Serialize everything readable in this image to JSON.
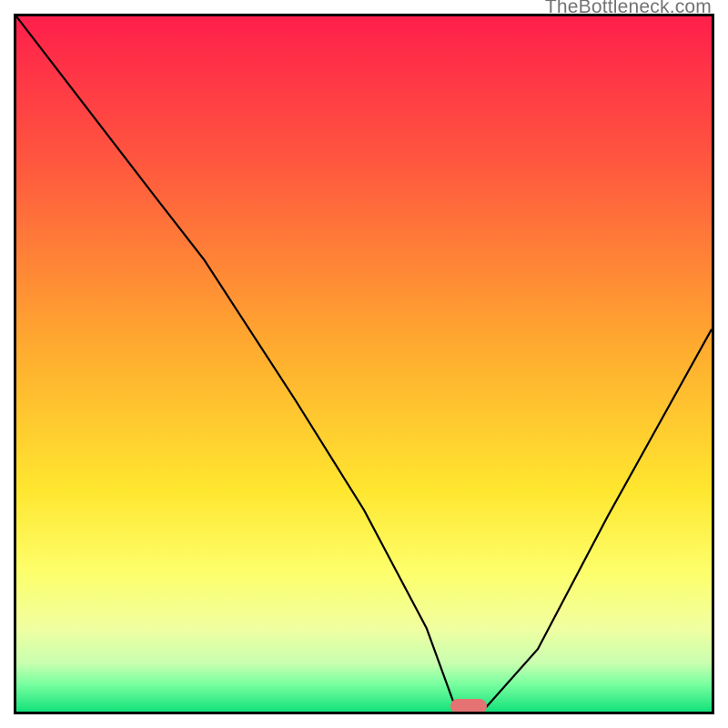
{
  "watermark": "TheBottleneck.com",
  "chart_data": {
    "type": "line",
    "title": "",
    "xlabel": "",
    "ylabel": "",
    "xlim": [
      0,
      100
    ],
    "ylim": [
      0,
      100
    ],
    "series": [
      {
        "name": "bottleneck-curve",
        "x": [
          0,
          10,
          20,
          27,
          40,
          50,
          59,
          63,
          67,
          75,
          85,
          100
        ],
        "y": [
          100,
          87,
          74,
          65,
          45,
          29,
          12,
          1,
          0,
          9,
          28,
          55
        ]
      }
    ],
    "marker": {
      "x": 65,
      "y": 0.8,
      "color": "#e57373"
    },
    "gradient_stops": [
      {
        "pct": 0,
        "color": "#ff1f4b"
      },
      {
        "pct": 22,
        "color": "#ff5a3e"
      },
      {
        "pct": 48,
        "color": "#ffac2f"
      },
      {
        "pct": 68,
        "color": "#ffe62f"
      },
      {
        "pct": 80,
        "color": "#fdff6b"
      },
      {
        "pct": 88,
        "color": "#f0ffa0"
      },
      {
        "pct": 93,
        "color": "#c9ffb0"
      },
      {
        "pct": 96,
        "color": "#7affa0"
      },
      {
        "pct": 100,
        "color": "#13e27b"
      }
    ]
  }
}
